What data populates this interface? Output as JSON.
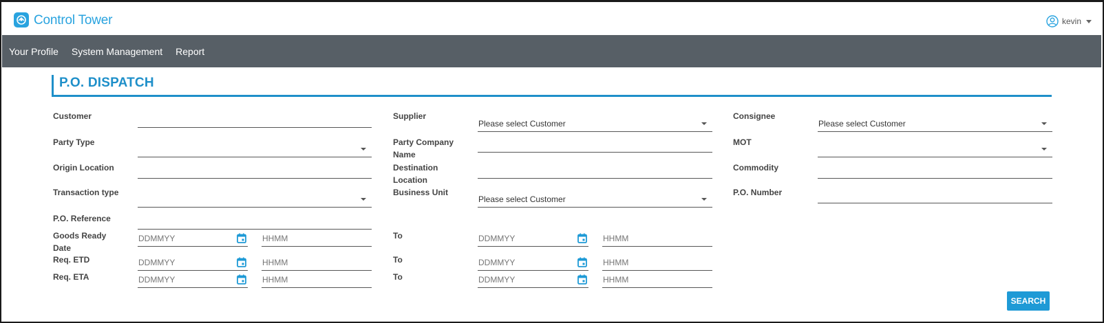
{
  "app": {
    "brand": "Control Tower"
  },
  "user": {
    "name": "kevin"
  },
  "nav": [
    {
      "label": "Your Profile"
    },
    {
      "label": "System Management"
    },
    {
      "label": "Report"
    }
  ],
  "page": {
    "title": "P.O. DISPATCH"
  },
  "form": {
    "customer_label": "Customer",
    "party_type_label": "Party Type",
    "origin_location_label": "Origin Location",
    "transaction_type_label": "Transaction type",
    "po_reference_label": "P.O. Reference",
    "goods_ready_date_label": "Goods Ready Date",
    "req_etd_label": "Req. ETD",
    "req_eta_label": "Req. ETA",
    "supplier_label": "Supplier",
    "supplier_value": "Please select Customer",
    "party_company_name_label": "Party Company Name",
    "destination_location_label": "Destination Location",
    "business_unit_label": "Business Unit",
    "business_unit_value": "Please select Customer",
    "to_label": "To",
    "consignee_label": "Consignee",
    "consignee_value": "Please select Customer",
    "mot_label": "MOT",
    "commodity_label": "Commodity",
    "po_number_label": "P.O. Number",
    "date_placeholder": "DDMMYY",
    "time_placeholder": "HHMM"
  },
  "actions": {
    "search_label": "SEARCH"
  },
  "colors": {
    "accent": "#1e8fc9",
    "nav_bg": "#575f66",
    "button": "#1e9ad6"
  }
}
